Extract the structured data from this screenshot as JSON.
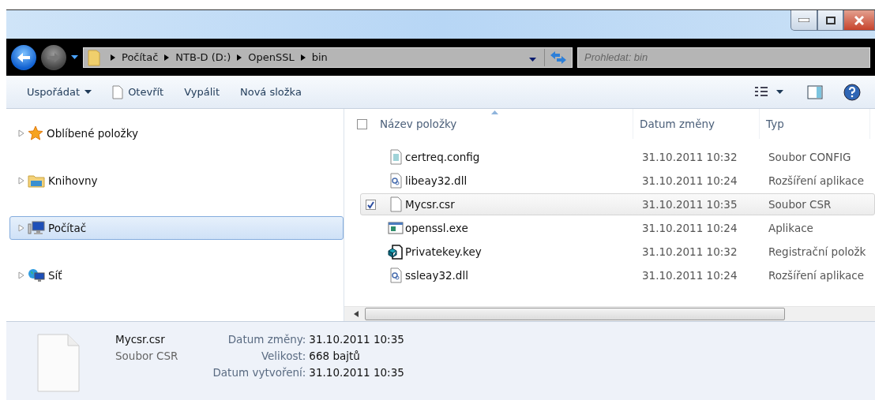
{
  "address_bar": {
    "crumbs": [
      "Počítač",
      "NTB-D (D:)",
      "OpenSSL",
      "bin"
    ]
  },
  "search": {
    "placeholder": "Prohledat: bin"
  },
  "toolbar": {
    "items": [
      {
        "label": "Uspořádat",
        "kind": "menu"
      },
      {
        "label": "Otevřít",
        "kind": "file"
      },
      {
        "label": "Vypálit",
        "kind": "plain"
      },
      {
        "label": "Nová složka",
        "kind": "plain"
      }
    ]
  },
  "sidebar": {
    "items": [
      {
        "label": "Oblíbené položky",
        "kind": "star",
        "selected": false
      },
      {
        "label": "Knihovny",
        "kind": "library",
        "selected": false
      },
      {
        "label": "Počítač",
        "kind": "computer",
        "selected": true
      },
      {
        "label": "Síť",
        "kind": "network",
        "selected": false
      }
    ]
  },
  "table": {
    "columns": [
      "Název položky",
      "Datum změny",
      "Typ"
    ],
    "select_all": {
      "checked": false
    },
    "rows": [
      {
        "name": "certreq.config",
        "date": "31.10.2011 10:32",
        "type": "Soubor CONFIG",
        "kind": "config",
        "selected": false
      },
      {
        "name": "libeay32.dll",
        "date": "31.10.2011 10:24",
        "type": "Rozšíření aplikace",
        "kind": "dll",
        "selected": false
      },
      {
        "name": "Mycsr.csr",
        "date": "31.10.2011 10:35",
        "type": "Soubor CSR",
        "kind": "blank",
        "selected": true
      },
      {
        "name": "openssl.exe",
        "date": "31.10.2011 10:24",
        "type": "Aplikace",
        "kind": "exe",
        "selected": false
      },
      {
        "name": "Privatekey.key",
        "date": "31.10.2011 10:32",
        "type": "Registrační položk",
        "kind": "key",
        "selected": false
      },
      {
        "name": "ssleay32.dll",
        "date": "31.10.2011 10:24",
        "type": "Rozšíření aplikace",
        "kind": "dll",
        "selected": false
      }
    ]
  },
  "details": {
    "name": "Mycsr.csr",
    "type": "Soubor CSR",
    "fields": [
      {
        "label": "Datum změny:",
        "value": "31.10.2011 10:35"
      },
      {
        "label": "Velikost:",
        "value": "668 bajtů"
      },
      {
        "label": "Datum vytvoření:",
        "value": "31.10.2011 10:35"
      }
    ]
  }
}
